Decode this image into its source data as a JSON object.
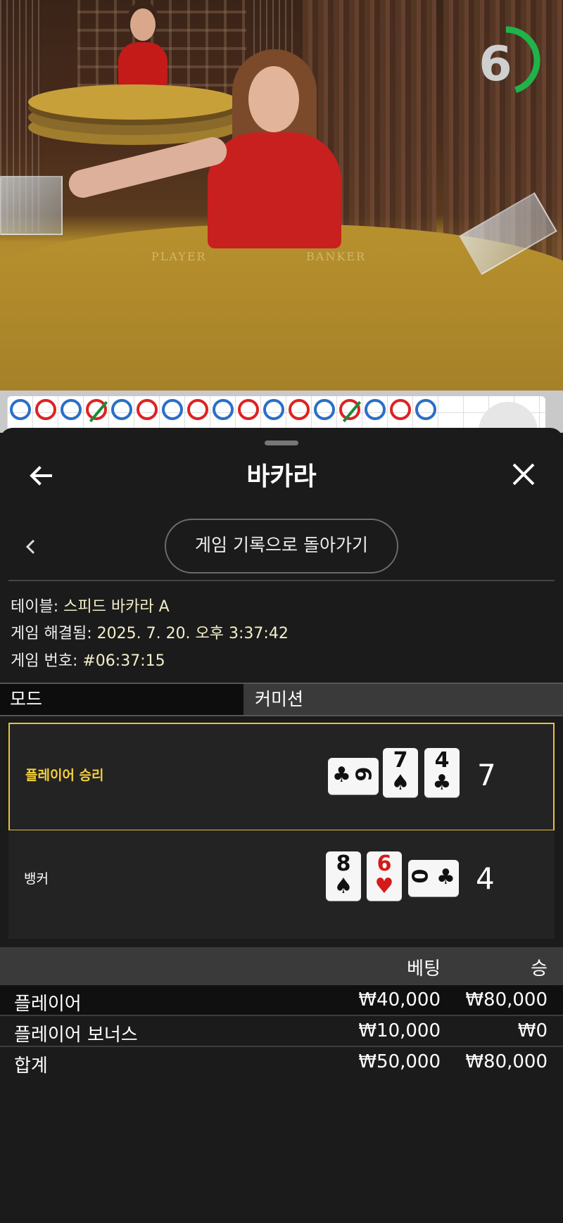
{
  "stream": {
    "countdown": "6",
    "countdown_progress": 0.45,
    "felt_labels": [
      "PLAYER",
      "BANKER"
    ]
  },
  "roadmap": {
    "cells": [
      "b",
      "r",
      "b",
      "r-tie",
      "b",
      "r",
      "b",
      "r",
      "b",
      "r",
      "b",
      "r",
      "b",
      "r-tie",
      "b",
      "r",
      "b"
    ]
  },
  "header": {
    "title": "바카라",
    "back_icon": "arrow-left-icon",
    "close_icon": "close-icon"
  },
  "nav": {
    "history_button": "게임 기록으로 돌아가기",
    "prev_icon": "chevron-left-icon"
  },
  "info": {
    "table_label": "테이블: ",
    "table_value": "스피드 바카라 A",
    "resolved_label": "게임 해결됨: ",
    "resolved_value": "2025. 7. 20. 오후 3:37:42",
    "game_no_label": "게임 번호: ",
    "game_no_value": "#06:37:15"
  },
  "tabs": {
    "mode": "모드",
    "commission": "커미션"
  },
  "hands": {
    "player": {
      "label": "플레이어 승리",
      "score": "7",
      "cards": [
        {
          "rank": "6",
          "suit": "♣",
          "orientation": "horizontal"
        },
        {
          "rank": "7",
          "suit": "♠",
          "orientation": "vertical"
        },
        {
          "rank": "4",
          "suit": "♣",
          "orientation": "vertical"
        }
      ]
    },
    "banker": {
      "label": "뱅커",
      "score": "4",
      "cards": [
        {
          "rank": "8",
          "suit": "♠",
          "orientation": "vertical"
        },
        {
          "rank": "6",
          "suit": "♥",
          "orientation": "vertical"
        },
        {
          "rank": "0",
          "suit": "♣",
          "orientation": "horizontal"
        }
      ]
    }
  },
  "bets": {
    "col_bet": "베팅",
    "col_win": "승",
    "rows": [
      {
        "name": "플레이어",
        "bet": "₩40,000",
        "win": "₩80,000"
      },
      {
        "name": "플레이어 보너스",
        "bet": "₩10,000",
        "win": "₩0"
      }
    ],
    "total": {
      "name": "합계",
      "bet": "₩50,000",
      "win": "₩80,000"
    }
  },
  "colors": {
    "accent_gold": "#e8c23a",
    "timer_green": "#1fb34a",
    "panel_bg": "#1b1b1b",
    "heart_red": "#d41a1a"
  }
}
